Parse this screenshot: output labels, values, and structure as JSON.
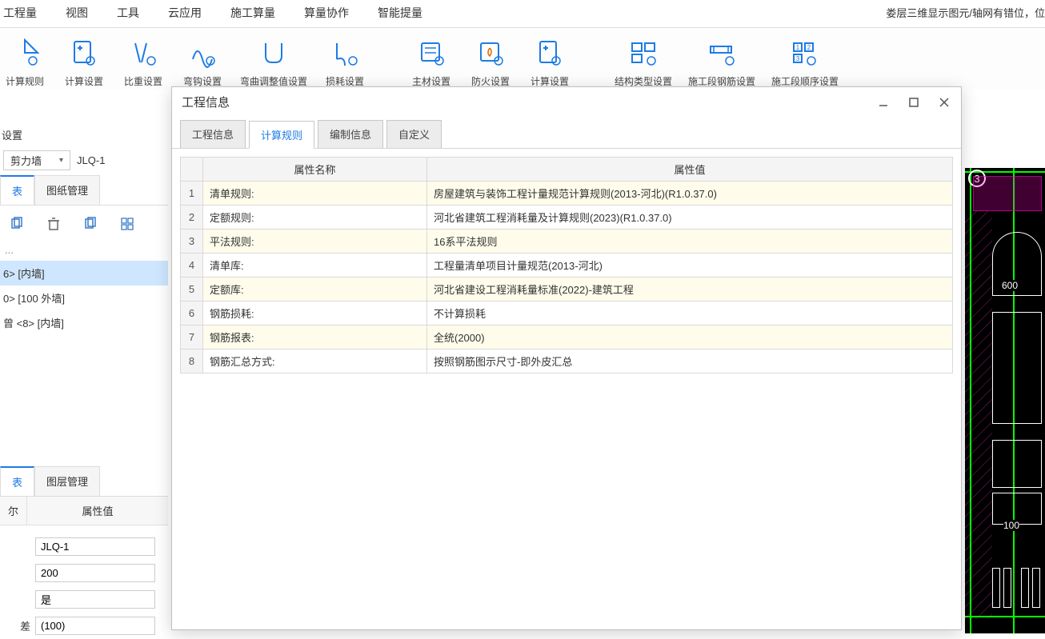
{
  "menu": {
    "items": [
      "工程量",
      "视图",
      "工具",
      "云应用",
      "施工算量",
      "算量协作",
      "智能提量"
    ],
    "status_right": "娄层三维显示图元/轴网有错位，位"
  },
  "ribbon": [
    {
      "icon": "rules-icon",
      "label": "计算规则"
    },
    {
      "icon": "calc-settings-icon",
      "label": "计算设置"
    },
    {
      "icon": "ratio-icon",
      "label": "比重设置"
    },
    {
      "icon": "bend-icon",
      "label": "弯钩设置"
    },
    {
      "icon": "bend-adj-icon",
      "label": "弯曲调整值设置"
    },
    {
      "icon": "loss-icon",
      "label": "损耗设置"
    },
    {
      "icon": "main-mat-icon",
      "label": "主材设置"
    },
    {
      "icon": "fire-icon",
      "label": "防火设置"
    },
    {
      "icon": "calc-cfg-icon",
      "label": "计算设置"
    },
    {
      "icon": "struct-type-icon",
      "label": "结构类型设置"
    },
    {
      "icon": "phase-rebar-icon",
      "label": "施工段钢筋设置"
    },
    {
      "icon": "phase-order-icon",
      "label": "施工段顺序设置"
    }
  ],
  "left": {
    "section_label": "设置",
    "wall_type": "剪力墙",
    "wall_code": "JLQ-1",
    "tabs": {
      "list": "构件列表",
      "dwg": "图纸管理",
      "list_short": "表"
    },
    "tree": [
      "6> [内墙]",
      "0> [100 外墙]",
      "曾 <8> [内墙]"
    ],
    "search_placeholder": "...",
    "prop_tabs": {
      "attr": "属性列表",
      "layer": "图层管理",
      "attr_short": "表"
    },
    "prop_headers": {
      "name": "名称",
      "value": "属性值",
      "name_short": "尔"
    },
    "prop_rows": [
      {
        "label": "",
        "value": "JLQ-1"
      },
      {
        "label": "",
        "value": "200"
      },
      {
        "label": "",
        "value": "是"
      },
      {
        "label": "差",
        "value": "(100)"
      }
    ]
  },
  "dialog": {
    "title": "工程信息",
    "tabs": [
      "工程信息",
      "计算规则",
      "编制信息",
      "自定义"
    ],
    "active_tab": 1,
    "columns": {
      "name": "属性名称",
      "value": "属性值"
    },
    "rows": [
      {
        "n": "1",
        "name": "清单规则:",
        "value": "房屋建筑与装饰工程计量规范计算规则(2013-河北)(R1.0.37.0)"
      },
      {
        "n": "2",
        "name": "定额规则:",
        "value": "河北省建筑工程消耗量及计算规则(2023)(R1.0.37.0)"
      },
      {
        "n": "3",
        "name": "平法规则:",
        "value": "16系平法规则"
      },
      {
        "n": "4",
        "name": "清单库:",
        "value": "工程量清单项目计量规范(2013-河北)"
      },
      {
        "n": "5",
        "name": "定额库:",
        "value": "河北省建设工程消耗量标准(2022)-建筑工程"
      },
      {
        "n": "6",
        "name": "钢筋损耗:",
        "value": "不计算损耗"
      },
      {
        "n": "7",
        "name": "钢筋报表:",
        "value": "全统(2000)"
      },
      {
        "n": "8",
        "name": "钢筋汇总方式:",
        "value": "按照钢筋图示尺寸-即外皮汇总"
      }
    ]
  },
  "canvas": {
    "axis_badge": "3",
    "dim1": "600",
    "dim2": "100"
  }
}
